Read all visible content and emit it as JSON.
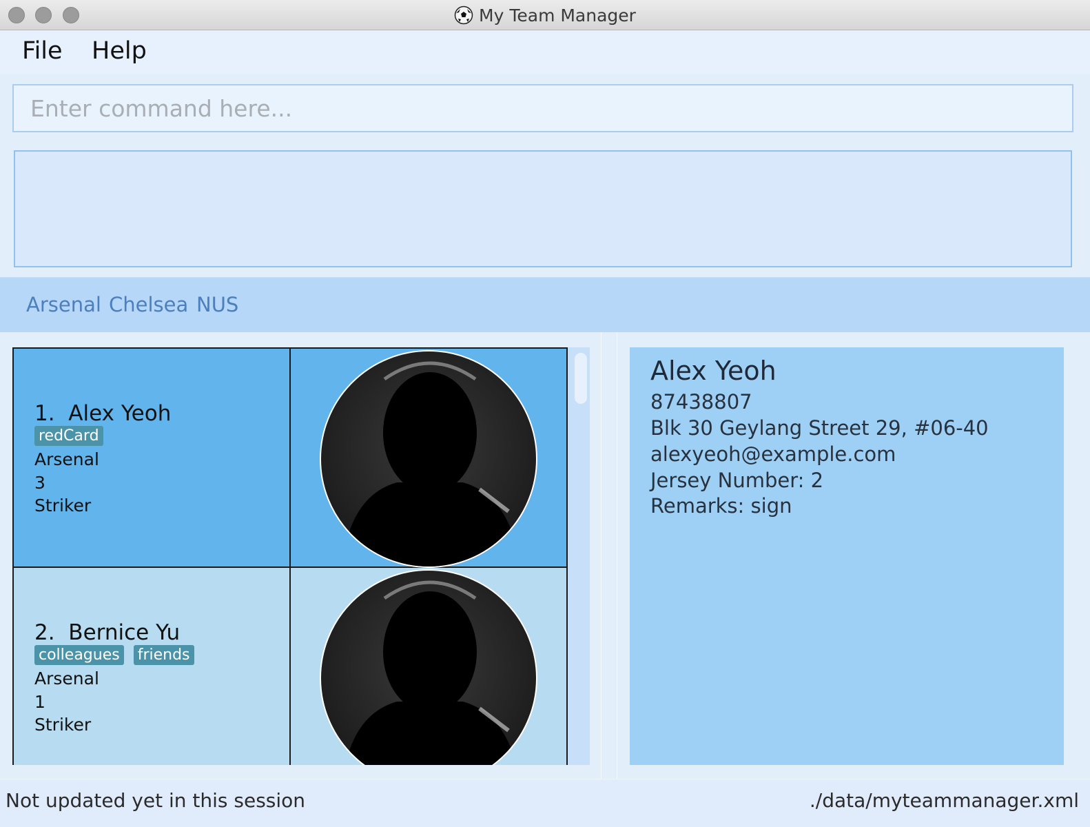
{
  "window": {
    "title": "My Team Manager",
    "icon": "soccer-ball-icon"
  },
  "menu": {
    "items": [
      "File",
      "Help"
    ]
  },
  "command": {
    "placeholder": "Enter command here...",
    "value": ""
  },
  "result": {
    "text": ""
  },
  "teams": [
    "Arsenal",
    "Chelsea",
    "NUS"
  ],
  "players": [
    {
      "index": "1.",
      "name": "Alex Yeoh",
      "tags": [
        "redCard"
      ],
      "team": "Arsenal",
      "jersey": "3",
      "position": "Striker",
      "selected": true
    },
    {
      "index": "2.",
      "name": "Bernice Yu",
      "tags": [
        "colleagues",
        "friends"
      ],
      "team": "Arsenal",
      "jersey": "1",
      "position": "Striker",
      "selected": false
    }
  ],
  "detail": {
    "name": "Alex Yeoh",
    "phone": "87438807",
    "address": "Blk 30 Geylang Street 29, #06-40",
    "email": "alexyeoh@example.com",
    "jersey": "Jersey Number: 2",
    "remarks": "Remarks: sign"
  },
  "status": {
    "left": "Not updated yet in this session",
    "right": "./data/myteammanager.xml"
  },
  "colors": {
    "selected_card": "#62b4ec",
    "card": "#b7dbf0",
    "tag": "#4b93a8",
    "team_link": "#4b7fbe",
    "detail_bg": "#9ecff4"
  }
}
